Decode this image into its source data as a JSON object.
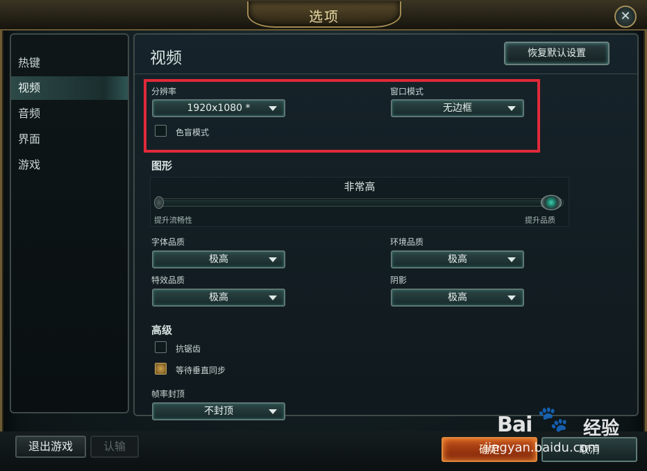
{
  "window": {
    "title": "选项"
  },
  "sidebar": {
    "items": [
      {
        "label": "热键",
        "active": false
      },
      {
        "label": "视频",
        "active": true
      },
      {
        "label": "音频",
        "active": false
      },
      {
        "label": "界面",
        "active": false
      },
      {
        "label": "游戏",
        "active": false
      }
    ]
  },
  "main": {
    "title": "视频",
    "restore_defaults": "恢复默认设置",
    "resolution": {
      "label": "分辨率",
      "value": "1920x1080 *"
    },
    "window_mode": {
      "label": "窗口模式",
      "value": "无边框"
    },
    "colorblind": {
      "label": "色盲模式",
      "checked": false
    },
    "graphics": {
      "heading": "图形",
      "level_label": "非常高",
      "slider_value": 1.0,
      "min_label": "提升流畅性",
      "max_label": "提升品质"
    },
    "quality": {
      "character": {
        "label": "字体品质",
        "value": "极高"
      },
      "environment": {
        "label": "环境品质",
        "value": "极高"
      },
      "effects": {
        "label": "特效品质",
        "value": "极高"
      },
      "shadows": {
        "label": "阴影",
        "value": "极高"
      }
    },
    "advanced": {
      "heading": "高级",
      "antialiasing": {
        "label": "抗锯齿",
        "checked": false
      },
      "vsync": {
        "label": "等待垂直同步",
        "checked": true
      },
      "framerate": {
        "label": "帧率封顶",
        "value": "不封顶"
      }
    }
  },
  "footer": {
    "exit": "退出游戏",
    "surrender": "认输",
    "confirm": "确定",
    "cancel": "取消"
  },
  "watermark": {
    "brand": "Bai",
    "brand_cn": "经验",
    "url": "jingyan.baidu.com"
  },
  "colors": {
    "highlight": "#e02a3a",
    "accent_gold": "#a08a52",
    "accent_teal": "#2e6a66"
  }
}
